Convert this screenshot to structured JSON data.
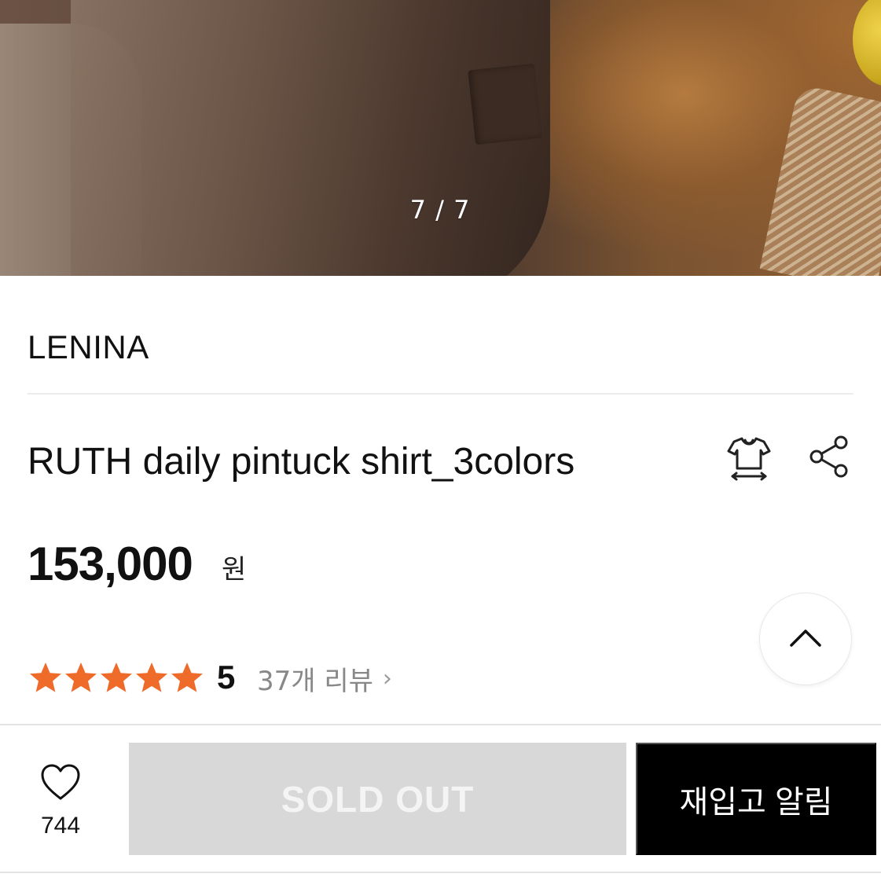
{
  "gallery": {
    "counter": "7 / 7"
  },
  "product": {
    "brand": "LENINA",
    "title": "RUTH daily pintuck shirt_3colors",
    "price": "153,000",
    "currency": "원"
  },
  "rating": {
    "stars": 5,
    "score": "5",
    "reviews_label": "37개 리뷰",
    "chevron": "›",
    "star_color": "#ef6b2a"
  },
  "actions": {
    "like_count": "744",
    "sold_out_label": "SOLD OUT",
    "restock_label": "재입고 알림"
  },
  "icons": {
    "size": "tshirt-size-icon",
    "share": "share-icon",
    "scroll_top": "chevron-up-icon",
    "like": "heart-icon"
  }
}
